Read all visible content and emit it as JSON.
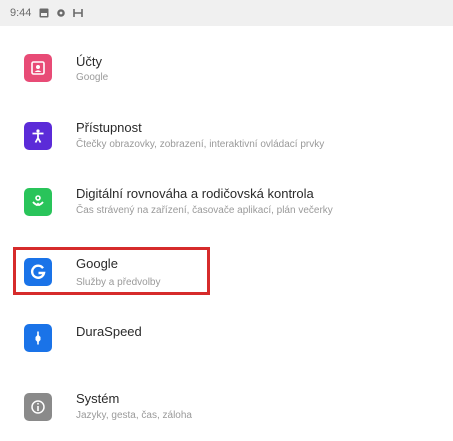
{
  "status_bar": {
    "time": "9:44",
    "icons": [
      "image-icon",
      "gear-icon",
      "data-icon"
    ]
  },
  "settings_list": [
    {
      "title": "Účty",
      "subtitle": "Google",
      "icon": "account-icon",
      "color": "#e84b76"
    },
    {
      "title": "Přístupnost",
      "subtitle": "Čtečky obrazovky, zobrazení, interaktivní ovládací prvky",
      "icon": "accessibility-icon",
      "color": "#5b2bd8"
    },
    {
      "title": "Digitální rovnováha a rodičovská kontrola",
      "subtitle": "Čas strávený na zařízení, časovače aplikací, plán večerky",
      "icon": "wellbeing-icon",
      "color": "#29c45a"
    },
    {
      "title": "Google",
      "subtitle": "Služby a předvolby",
      "icon": "google-icon",
      "color": "#1a73e8"
    },
    {
      "title": "DuraSpeed",
      "subtitle": "",
      "icon": "duraspeed-icon",
      "color": "#1a73e8"
    },
    {
      "title": "Systém",
      "subtitle": "Jazyky, gesta, čas, záloha",
      "icon": "info-icon",
      "color": "#8a8a8a"
    }
  ],
  "highlight_color": "#d62b2b"
}
